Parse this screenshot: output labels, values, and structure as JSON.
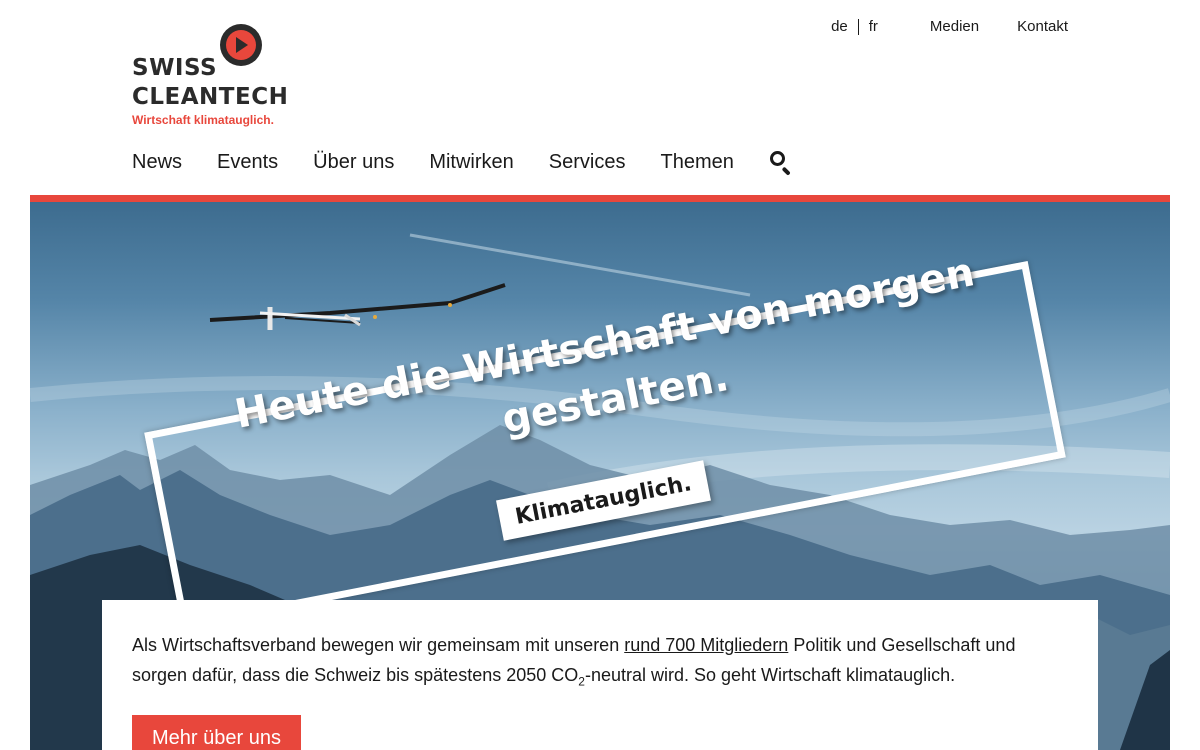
{
  "logo": {
    "line1": "SWISS",
    "line2": "CLEANTECH",
    "tagline": "Wirtschaft klimatauglich."
  },
  "topbar": {
    "languages": [
      "de",
      "fr"
    ],
    "links": [
      "Medien",
      "Kontakt"
    ]
  },
  "nav": {
    "items": [
      "News",
      "Events",
      "Über uns",
      "Mitwirken",
      "Services",
      "Themen"
    ]
  },
  "hero": {
    "headline": "Heute die Wirtschaft von morgen gestalten.",
    "claim": "Klimatauglich."
  },
  "intro": {
    "text_before": "Als Wirtschaftsverband bewegen wir gemeinsam mit unseren ",
    "link": "rund 700 Mitgliedern",
    "text_middle": " Politik und Gesellschaft und sorgen dafür, dass die Schweiz bis spätestens 2050 CO",
    "subscript": "2",
    "text_after": "-neutral wird. So geht Wirtschaft klimatauglich.",
    "button": "Mehr über uns"
  },
  "colors": {
    "accent": "#e8473c",
    "text": "#1a1a1a"
  }
}
